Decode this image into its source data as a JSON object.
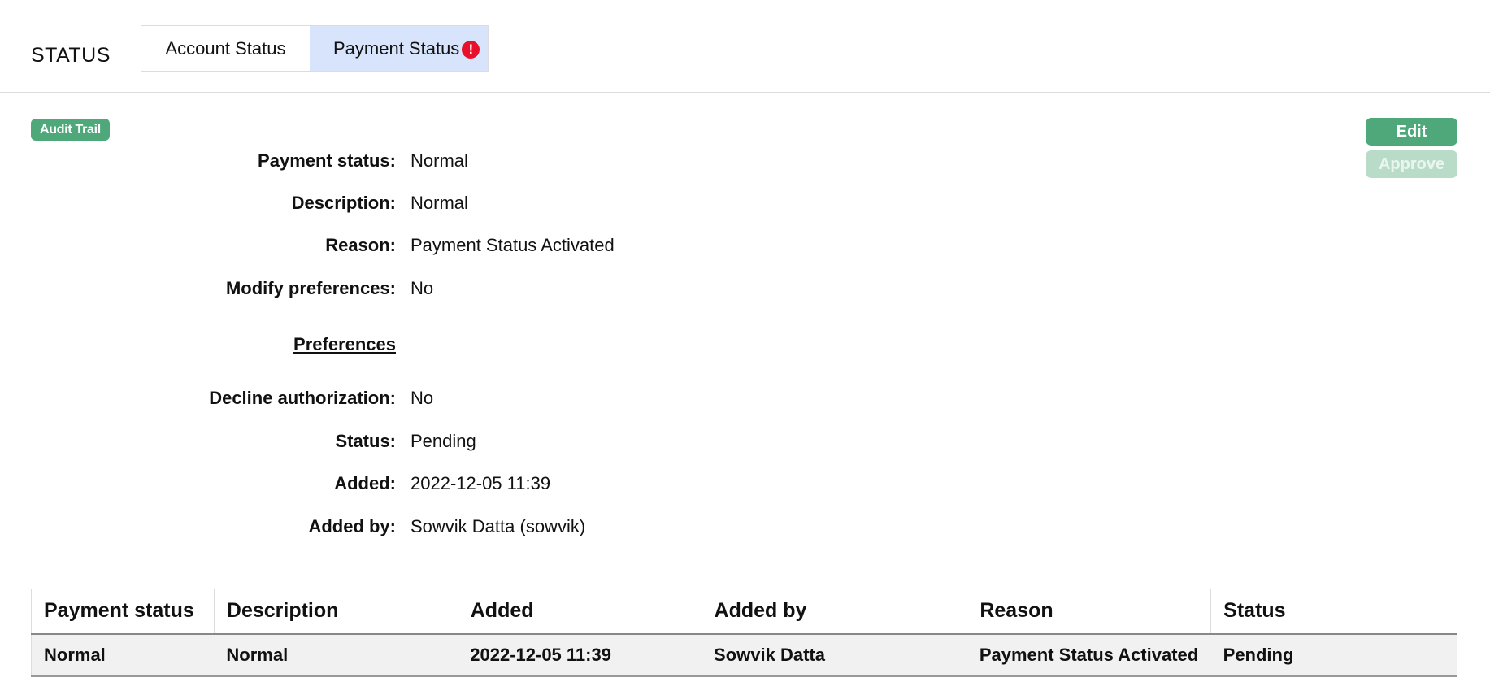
{
  "header": {
    "title": "STATUS",
    "tabs": [
      {
        "label": "Account Status",
        "active": false
      },
      {
        "label": "Payment Status",
        "active": true,
        "alert_icon": "exclamation-circle-icon"
      }
    ]
  },
  "badge": {
    "label": "Audit Trail"
  },
  "actions": {
    "edit_label": "Edit",
    "approve_label": "Approve",
    "approve_disabled": true
  },
  "details": {
    "payment_status": {
      "label": "Payment status:",
      "value": "Normal"
    },
    "description": {
      "label": "Description:",
      "value": "Normal"
    },
    "reason": {
      "label": "Reason:",
      "value": "Payment Status Activated"
    },
    "modify_preferences": {
      "label": "Modify preferences:",
      "value": "No"
    },
    "preferences_heading": "Preferences",
    "decline_authorization": {
      "label": "Decline authorization:",
      "value": "No"
    },
    "status": {
      "label": "Status:",
      "value": "Pending"
    },
    "added": {
      "label": "Added:",
      "value": "2022-12-05 11:39"
    },
    "added_by": {
      "label": "Added by:",
      "value": "Sowvik Datta (sowvik)"
    }
  },
  "history": {
    "columns": [
      "Payment status",
      "Description",
      "Added",
      "Added by",
      "Reason",
      "Status"
    ],
    "rows": [
      [
        "Normal",
        "Normal",
        "2022-12-05 11:39",
        "Sowvik Datta",
        "Payment Status Activated",
        "Pending"
      ]
    ]
  },
  "colors": {
    "accent_green": "#4ea87a",
    "active_tab_bg": "#d8e4fb",
    "alert_red": "#e8102a"
  }
}
